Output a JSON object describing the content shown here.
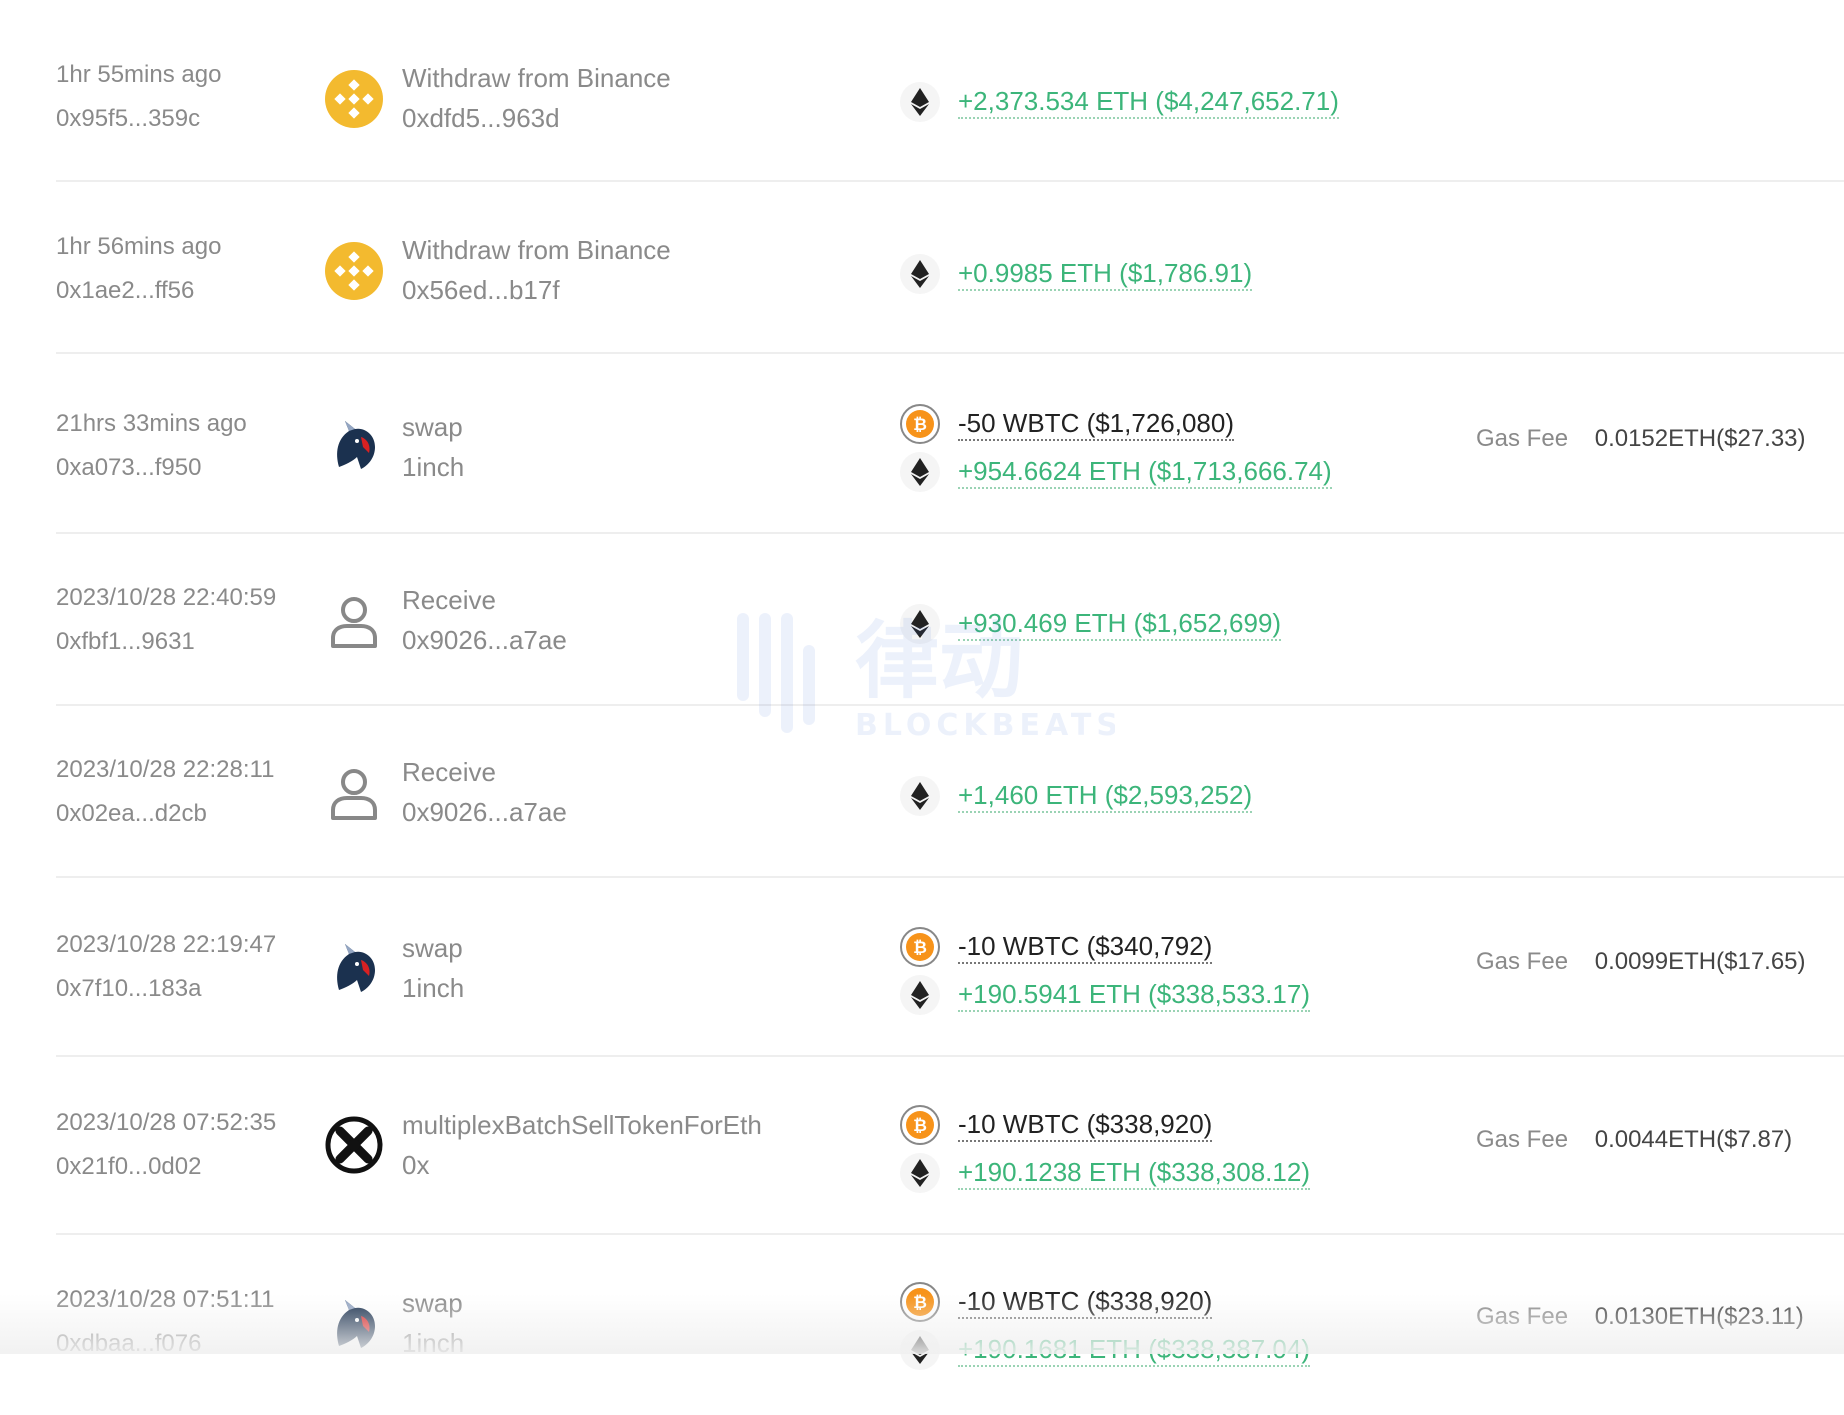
{
  "transactions": [
    {
      "time": "1hr 55mins ago",
      "hash": "0x95f5...359c",
      "icon": "binance-icon",
      "method": "Withdraw from Binance",
      "address": "0xdfd5...963d",
      "transfers": [
        {
          "token": "eth",
          "amount": "+2,373.534 ETH ($4,247,652.71)",
          "direction": "in"
        }
      ],
      "fee_label": "",
      "fee_value": ""
    },
    {
      "time": "1hr 56mins ago",
      "hash": "0x1ae2...ff56",
      "icon": "binance-icon",
      "method": "Withdraw from Binance",
      "address": "0x56ed...b17f",
      "transfers": [
        {
          "token": "eth",
          "amount": "+0.9985 ETH ($1,786.91)",
          "direction": "in"
        }
      ],
      "fee_label": "",
      "fee_value": ""
    },
    {
      "time": "21hrs 33mins ago",
      "hash": "0xa073...f950",
      "icon": "1inch-unicorn-icon",
      "method": "swap",
      "address": "1inch",
      "transfers": [
        {
          "token": "wbtc",
          "amount": "-50 WBTC ($1,726,080)",
          "direction": "out"
        },
        {
          "token": "eth",
          "amount": "+954.6624 ETH ($1,713,666.74)",
          "direction": "in"
        }
      ],
      "fee_label": "Gas Fee",
      "fee_value": "0.0152ETH($27.33)"
    },
    {
      "time": "2023/10/28 22:40:59",
      "hash": "0xfbf1...9631",
      "icon": "user-icon",
      "method": "Receive",
      "address": "0x9026...a7ae",
      "transfers": [
        {
          "token": "eth",
          "amount": "+930.469 ETH ($1,652,699)",
          "direction": "in"
        }
      ],
      "fee_label": "",
      "fee_value": ""
    },
    {
      "time": "2023/10/28 22:28:11",
      "hash": "0x02ea...d2cb",
      "icon": "user-icon",
      "method": "Receive",
      "address": "0x9026...a7ae",
      "transfers": [
        {
          "token": "eth",
          "amount": "+1,460 ETH ($2,593,252)",
          "direction": "in"
        }
      ],
      "fee_label": "",
      "fee_value": ""
    },
    {
      "time": "2023/10/28 22:19:47",
      "hash": "0x7f10...183a",
      "icon": "1inch-unicorn-icon",
      "method": "swap",
      "address": "1inch",
      "transfers": [
        {
          "token": "wbtc",
          "amount": "-10 WBTC ($340,792)",
          "direction": "out"
        },
        {
          "token": "eth",
          "amount": "+190.5941 ETH ($338,533.17)",
          "direction": "in"
        }
      ],
      "fee_label": "Gas Fee",
      "fee_value": "0.0099ETH($17.65)"
    },
    {
      "time": "2023/10/28 07:52:35",
      "hash": "0x21f0...0d02",
      "icon": "0x-protocol-icon",
      "method": "multiplexBatchSellTokenForEth",
      "address": "0x",
      "transfers": [
        {
          "token": "wbtc",
          "amount": "-10 WBTC ($338,920)",
          "direction": "out"
        },
        {
          "token": "eth",
          "amount": "+190.1238 ETH ($338,308.12)",
          "direction": "in"
        }
      ],
      "fee_label": "Gas Fee",
      "fee_value": "0.0044ETH($7.87)"
    },
    {
      "time": "2023/10/28 07:51:11",
      "hash": "0xdbaa...f076",
      "icon": "1inch-unicorn-icon",
      "method": "swap",
      "address": "1inch",
      "transfers": [
        {
          "token": "wbtc",
          "amount": "-10 WBTC ($338,920)",
          "direction": "out"
        },
        {
          "token": "eth",
          "amount": "+190.1681 ETH ($338,387.04)",
          "direction": "in"
        }
      ],
      "fee_label": "Gas Fee",
      "fee_value": "0.0130ETH($23.11)"
    }
  ],
  "watermark": {
    "text": "律动",
    "subtext": "BLOCKBEATS"
  },
  "colors": {
    "positive": "#3cb57a",
    "negative": "#222222",
    "muted": "#8a8a8a",
    "binance": "#f3ba2f",
    "btc": "#f7931a"
  }
}
